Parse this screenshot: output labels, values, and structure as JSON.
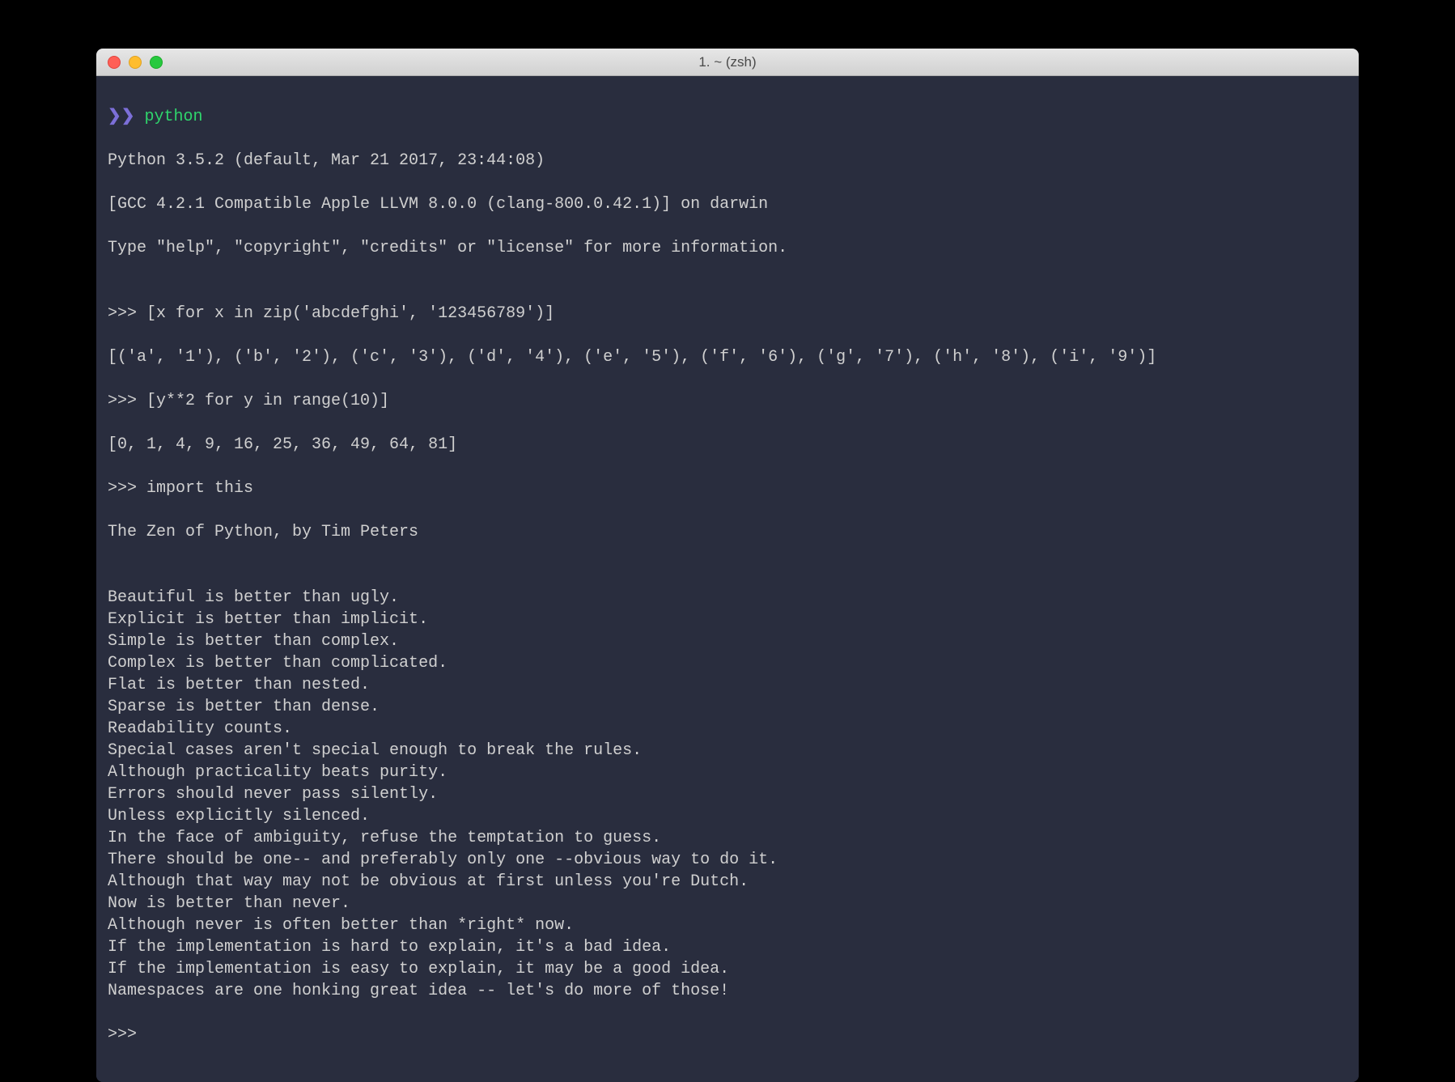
{
  "window": {
    "title": "1. ~ (zsh)"
  },
  "prompt": {
    "symbol": "❯❯",
    "command": "python"
  },
  "repl_prompt": ">>> ",
  "lines": {
    "banner1": "Python 3.5.2 (default, Mar 21 2017, 23:44:08)",
    "banner2": "[GCC 4.2.1 Compatible Apple LLVM 8.0.0 (clang-800.0.42.1)] on darwin",
    "banner3": "Type \"help\", \"copyright\", \"credits\" or \"license\" for more information.",
    "blank": "",
    "in1": ">>> [x for x in zip('abcdefghi', '123456789')]",
    "out1": "[('a', '1'), ('b', '2'), ('c', '3'), ('d', '4'), ('e', '5'), ('f', '6'), ('g', '7'), ('h', '8'), ('i', '9')]",
    "in2": ">>> [y**2 for y in range(10)]",
    "out2": "[0, 1, 4, 9, 16, 25, 36, 49, 64, 81]",
    "in3": ">>> import this",
    "zen_title": "The Zen of Python, by Tim Peters",
    "zen": [
      "Beautiful is better than ugly.",
      "Explicit is better than implicit.",
      "Simple is better than complex.",
      "Complex is better than complicated.",
      "Flat is better than nested.",
      "Sparse is better than dense.",
      "Readability counts.",
      "Special cases aren't special enough to break the rules.",
      "Although practicality beats purity.",
      "Errors should never pass silently.",
      "Unless explicitly silenced.",
      "In the face of ambiguity, refuse the temptation to guess.",
      "There should be one-- and preferably only one --obvious way to do it.",
      "Although that way may not be obvious at first unless you're Dutch.",
      "Now is better than never.",
      "Although never is often better than *right* now.",
      "If the implementation is hard to explain, it's a bad idea.",
      "If the implementation is easy to explain, it may be a good idea.",
      "Namespaces are one honking great idea -- let's do more of those!"
    ],
    "final_prompt": ">>>"
  }
}
